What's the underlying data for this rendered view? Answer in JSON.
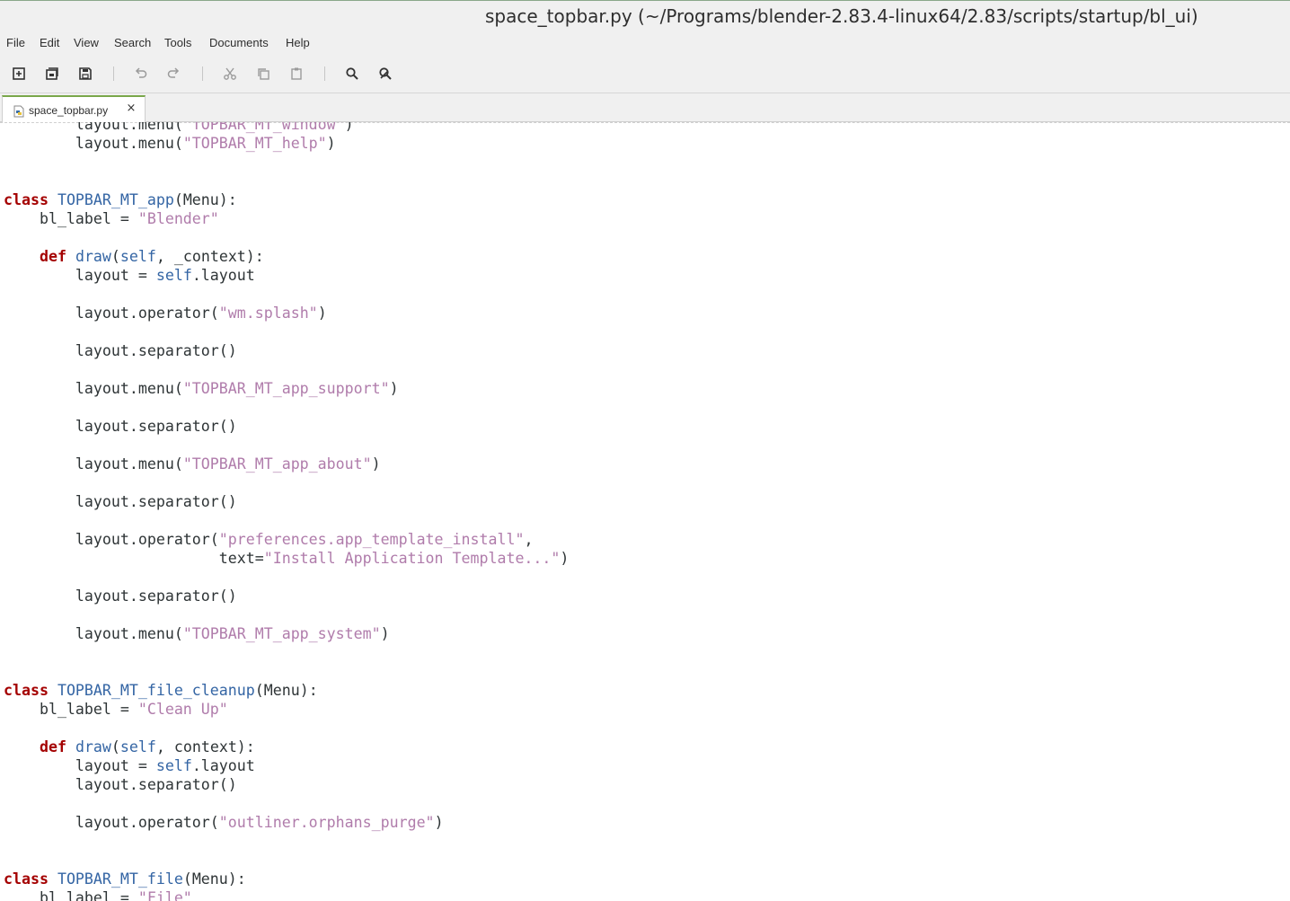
{
  "window": {
    "title": "space_topbar.py (~/Programs/blender-2.83.4-linux64/2.83/scripts/startup/bl_ui)"
  },
  "menubar": {
    "items": [
      "File",
      "Edit",
      "View",
      "Search",
      "Tools",
      "Documents",
      "Help"
    ]
  },
  "toolbar": {
    "buttons": [
      "new-document-icon",
      "open-recent-icon",
      "save-icon",
      "undo-icon",
      "redo-icon",
      "cut-icon",
      "copy-icon",
      "paste-icon",
      "find-icon",
      "find-replace-icon"
    ]
  },
  "tabs": [
    {
      "label": "space_topbar.py",
      "close": "×"
    }
  ],
  "colors": {
    "keyword": "#a40000",
    "class_name": "#3465a4",
    "string": "#b07cab",
    "text": "#2e3436",
    "tab_accent": "#7aa74a"
  },
  "code_lines": [
    [
      [
        "t",
        "        layout.menu("
      ],
      [
        "s",
        "\"TOPBAR_MT_window\""
      ],
      [
        "t",
        ")"
      ]
    ],
    [
      [
        "t",
        "        layout.menu("
      ],
      [
        "s",
        "\"TOPBAR_MT_help\""
      ],
      [
        "t",
        ")"
      ]
    ],
    [],
    [],
    [
      [
        "k",
        "class"
      ],
      [
        "t",
        " "
      ],
      [
        "c",
        "TOPBAR_MT_app"
      ],
      [
        "t",
        "(Menu):"
      ]
    ],
    [
      [
        "t",
        "    bl_label = "
      ],
      [
        "s",
        "\"Blender\""
      ]
    ],
    [],
    [
      [
        "t",
        "    "
      ],
      [
        "k",
        "def"
      ],
      [
        "t",
        " "
      ],
      [
        "c",
        "draw"
      ],
      [
        "t",
        "("
      ],
      [
        "c",
        "self"
      ],
      [
        "t",
        ", _context):"
      ]
    ],
    [
      [
        "t",
        "        layout = "
      ],
      [
        "c",
        "self"
      ],
      [
        "t",
        ".layout"
      ]
    ],
    [],
    [
      [
        "t",
        "        layout.operator("
      ],
      [
        "s",
        "\"wm.splash\""
      ],
      [
        "t",
        ")"
      ]
    ],
    [],
    [
      [
        "t",
        "        layout.separator()"
      ]
    ],
    [],
    [
      [
        "t",
        "        layout.menu("
      ],
      [
        "s",
        "\"TOPBAR_MT_app_support\""
      ],
      [
        "t",
        ")"
      ]
    ],
    [],
    [
      [
        "t",
        "        layout.separator()"
      ]
    ],
    [],
    [
      [
        "t",
        "        layout.menu("
      ],
      [
        "s",
        "\"TOPBAR_MT_app_about\""
      ],
      [
        "t",
        ")"
      ]
    ],
    [],
    [
      [
        "t",
        "        layout.separator()"
      ]
    ],
    [],
    [
      [
        "t",
        "        layout.operator("
      ],
      [
        "s",
        "\"preferences.app_template_install\""
      ],
      [
        "t",
        ","
      ]
    ],
    [
      [
        "t",
        "                        text="
      ],
      [
        "s",
        "\"Install Application Template...\""
      ],
      [
        "t",
        ")"
      ]
    ],
    [],
    [
      [
        "t",
        "        layout.separator()"
      ]
    ],
    [],
    [
      [
        "t",
        "        layout.menu("
      ],
      [
        "s",
        "\"TOPBAR_MT_app_system\""
      ],
      [
        "t",
        ")"
      ]
    ],
    [],
    [],
    [
      [
        "k",
        "class"
      ],
      [
        "t",
        " "
      ],
      [
        "c",
        "TOPBAR_MT_file_cleanup"
      ],
      [
        "t",
        "(Menu):"
      ]
    ],
    [
      [
        "t",
        "    bl_label = "
      ],
      [
        "s",
        "\"Clean Up\""
      ]
    ],
    [],
    [
      [
        "t",
        "    "
      ],
      [
        "k",
        "def"
      ],
      [
        "t",
        " "
      ],
      [
        "c",
        "draw"
      ],
      [
        "t",
        "("
      ],
      [
        "c",
        "self"
      ],
      [
        "t",
        ", context):"
      ]
    ],
    [
      [
        "t",
        "        layout = "
      ],
      [
        "c",
        "self"
      ],
      [
        "t",
        ".layout"
      ]
    ],
    [
      [
        "t",
        "        layout.separator()"
      ]
    ],
    [],
    [
      [
        "t",
        "        layout.operator("
      ],
      [
        "s",
        "\"outliner.orphans_purge\""
      ],
      [
        "t",
        ")"
      ]
    ],
    [],
    [],
    [
      [
        "k",
        "class"
      ],
      [
        "t",
        " "
      ],
      [
        "c",
        "TOPBAR_MT_file"
      ],
      [
        "t",
        "(Menu):"
      ]
    ],
    [
      [
        "t",
        "    bl_label = "
      ],
      [
        "s",
        "\"File\""
      ]
    ]
  ]
}
